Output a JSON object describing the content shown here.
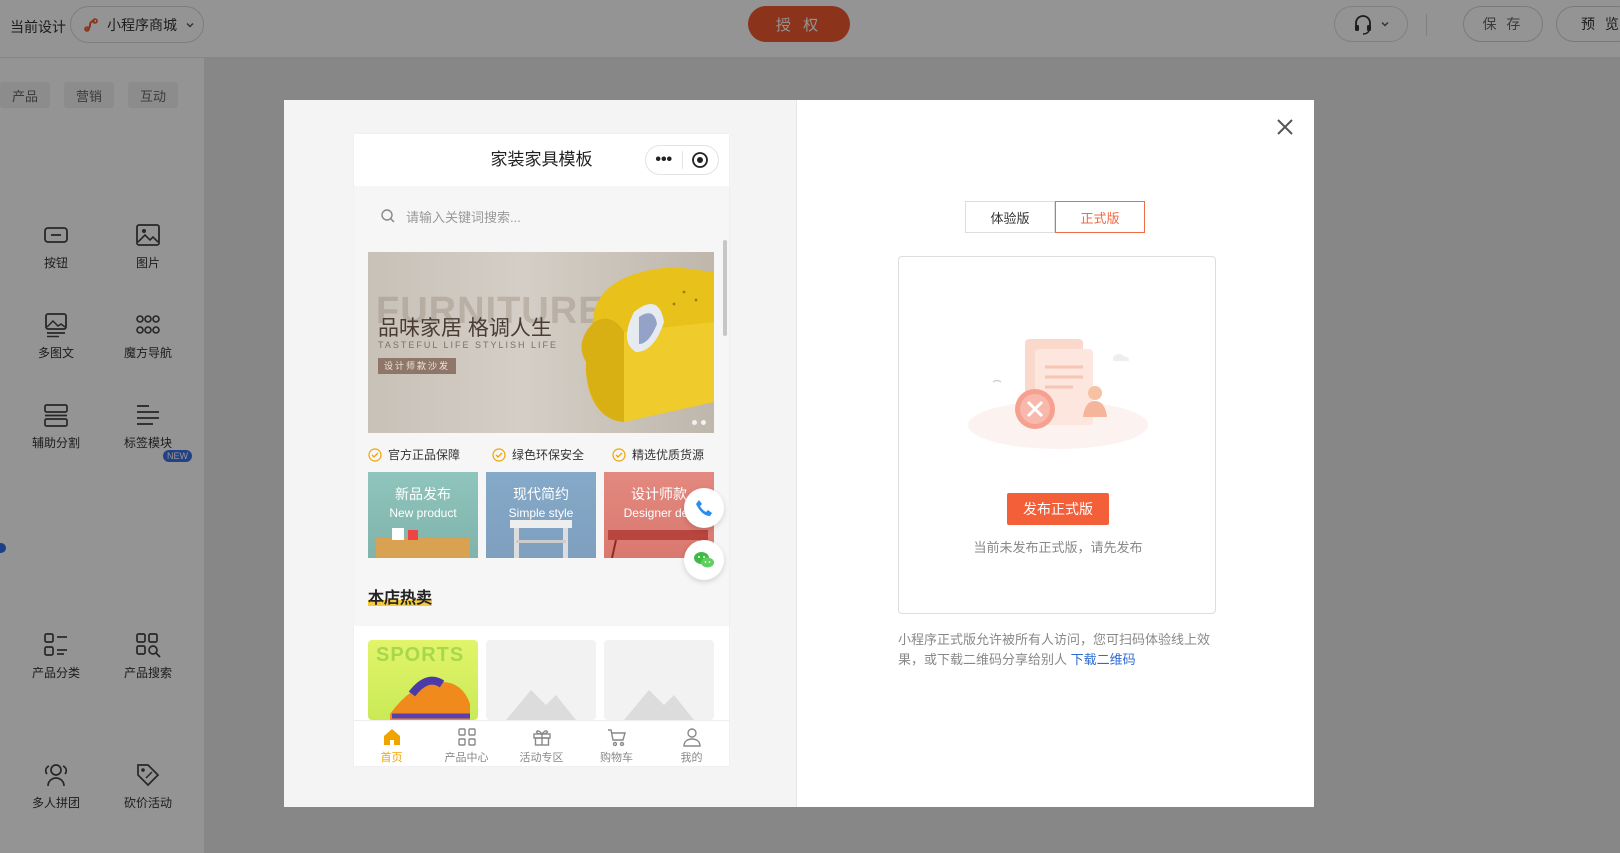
{
  "topbar": {
    "current_design_label": "当前设计",
    "design_name": "小程序商城",
    "auth_label": "授 权",
    "save_label": "保 存",
    "preview_label": "预 览"
  },
  "sidebar": {
    "tabs": [
      "产品",
      "营销",
      "互动"
    ],
    "components": [
      {
        "label": "按钮",
        "icon": "button-icon"
      },
      {
        "label": "图片",
        "icon": "image-icon"
      },
      {
        "label": "多图文",
        "icon": "multi-image-text-icon"
      },
      {
        "label": "魔方导航",
        "icon": "grid-nav-icon"
      },
      {
        "label": "辅助分割",
        "icon": "divider-icon"
      },
      {
        "label": "标签模块",
        "icon": "tag-module-icon"
      },
      {
        "label": "产品分类",
        "icon": "product-category-icon"
      },
      {
        "label": "产品搜索",
        "icon": "product-search-icon"
      },
      {
        "label": "多人拼团",
        "icon": "group-buy-icon"
      },
      {
        "label": "砍价活动",
        "icon": "bargain-icon"
      }
    ],
    "new_badge": "NEW"
  },
  "phone": {
    "title": "家装家具模板",
    "capsule_dots": "•••",
    "search_placeholder": "请输入关键词搜索...",
    "banner": {
      "bg_text": "FURNITURE",
      "title": "品味家居 格调人生",
      "subtitle": "TASTEFUL LIFE STYLISH LIFE",
      "tag": "设计师款沙发"
    },
    "guarantees": [
      "官方正品保障",
      "绿色环保安全",
      "精选优质货源"
    ],
    "categories": [
      {
        "name": "新品发布",
        "en": "New product"
      },
      {
        "name": "现代简约",
        "en": "Simple style"
      },
      {
        "name": "设计师款",
        "en": "Designer des"
      }
    ],
    "hot_title": "本店热卖",
    "product_text": "SPORTS",
    "tabs": [
      "首页",
      "产品中心",
      "活动专区",
      "购物车",
      "我的"
    ]
  },
  "publish": {
    "version_tabs": [
      "体验版",
      "正式版"
    ],
    "active_tab": "正式版",
    "publish_button": "发布正式版",
    "qr_note": "当前未发布正式版，请先发布",
    "desc_text": "小程序正式版允许被所有人访问，您可扫码体验线上效果，或下载二维码分享给别人 ",
    "download_link": "下载二维码"
  },
  "colors": {
    "accent": "#ef5a2f",
    "tab_active": "#f0a400",
    "link": "#2e6ad1"
  }
}
